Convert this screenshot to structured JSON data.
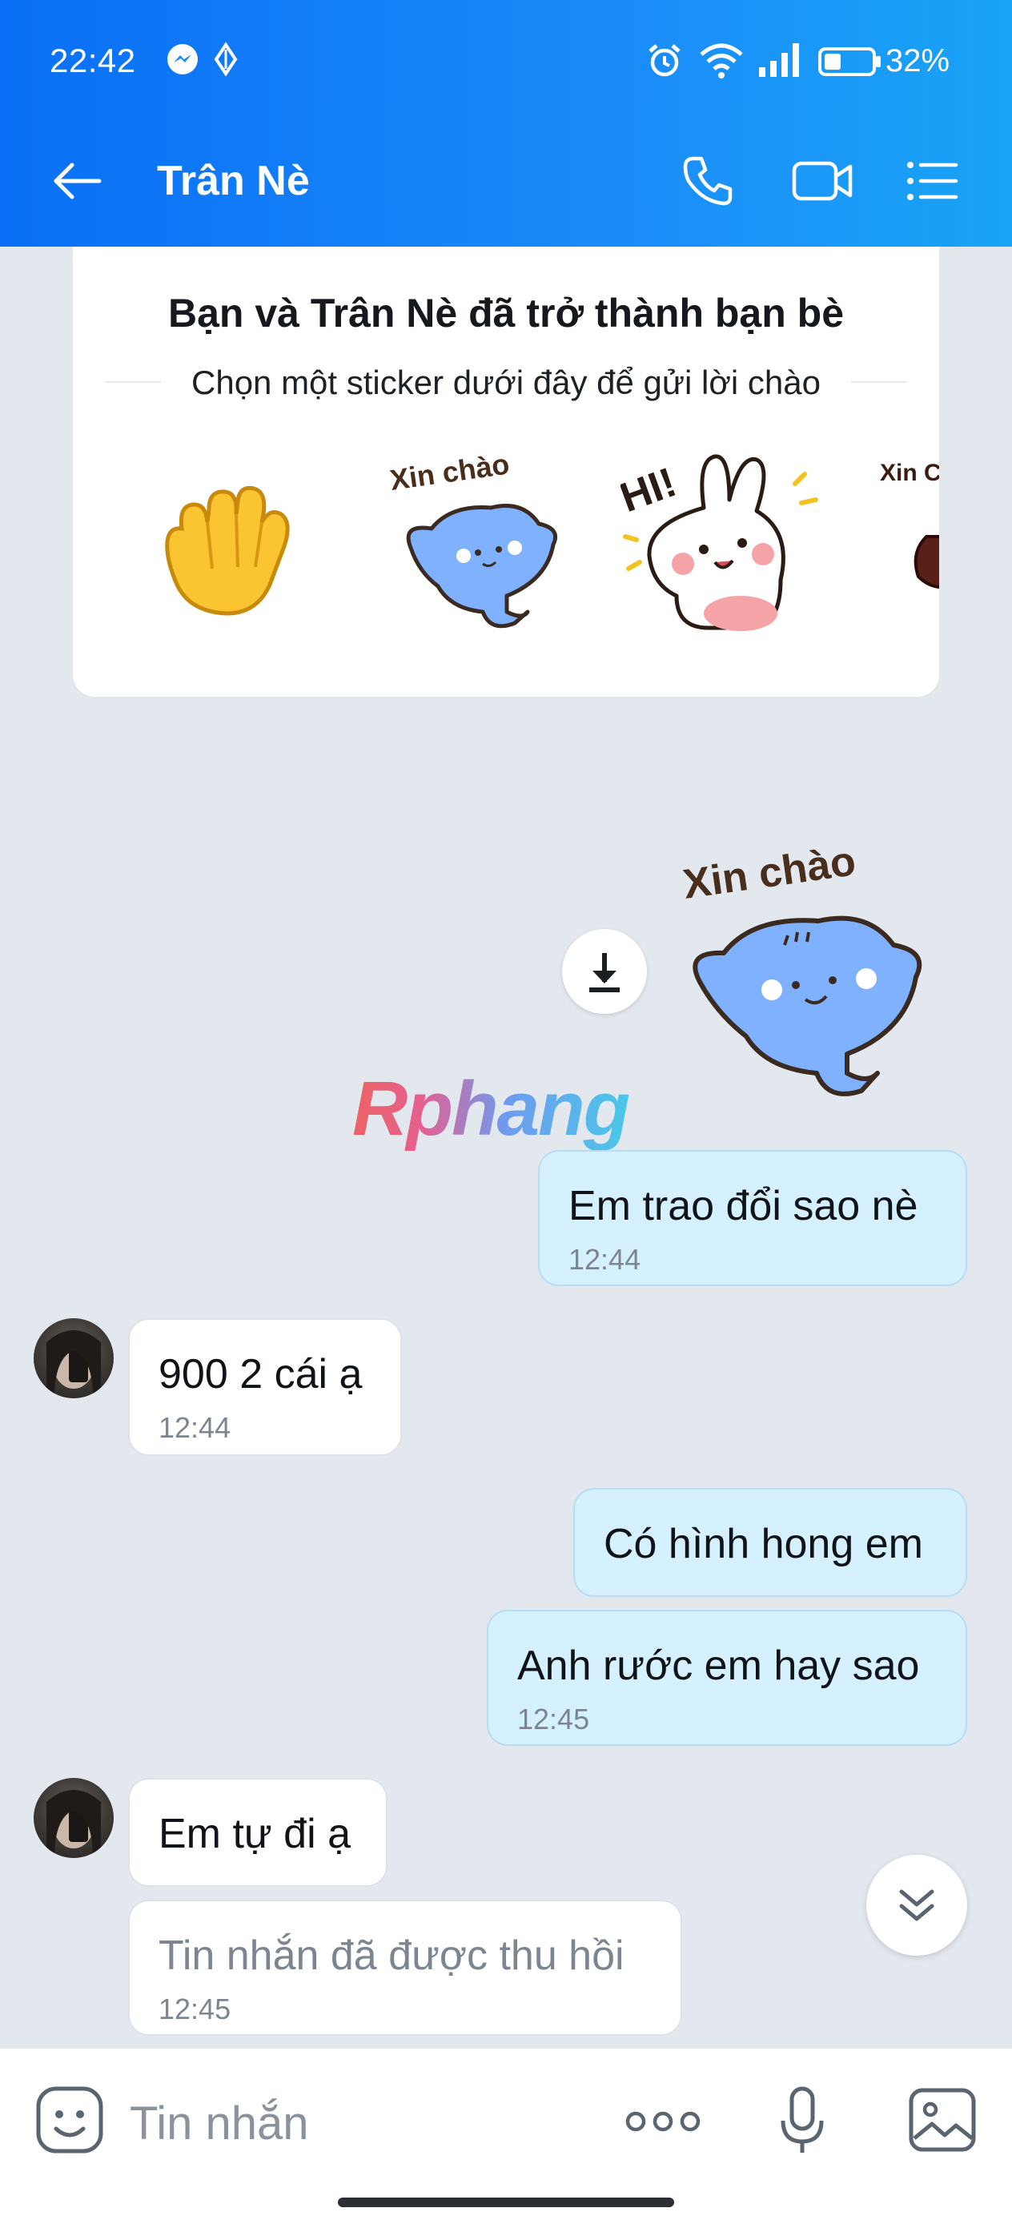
{
  "status_bar": {
    "time": "22:42",
    "battery": "32%",
    "icons": [
      "messenger-icon",
      "location-icon",
      "alarm-icon",
      "wifi-icon",
      "signal-icon",
      "battery-icon"
    ]
  },
  "app_bar": {
    "title": "Trân Nè",
    "back_icon": "arrow-left-icon",
    "actions": [
      "phone-icon",
      "video-call-icon",
      "menu-list-icon"
    ]
  },
  "friend_card": {
    "title": "Bạn và Trân Nè đã trở thành bạn bè",
    "subtitle": "Chọn một sticker dưới đây để gửi lời chào",
    "stickers": [
      {
        "name": "wave-hand-sticker"
      },
      {
        "name": "xin-chao-cat-sticker",
        "text": "Xin chào"
      },
      {
        "name": "hi-bunny-sticker",
        "text": "HI!"
      },
      {
        "name": "xin-chao-partial-sticker",
        "text": "Xin Chà"
      }
    ]
  },
  "watermark": "Rphang",
  "messages": [
    {
      "side": "out",
      "type": "sticker",
      "sticker_text": "Xin chào"
    },
    {
      "side": "out",
      "text": "Em trao đổi sao nè",
      "time": "12:44"
    },
    {
      "side": "in",
      "text": "900 2 cái ạ",
      "time": "12:44"
    },
    {
      "side": "out",
      "text": "Có hình hong em",
      "time": ""
    },
    {
      "side": "out",
      "text": "Anh rước em hay sao",
      "time": "12:45"
    },
    {
      "side": "in",
      "text": "Em tự đi ạ",
      "time": ""
    },
    {
      "side": "in",
      "text": "Tin nhắn đã được thu hồi",
      "time": "12:45",
      "recalled": true
    }
  ],
  "composer": {
    "placeholder": "Tin nhắn",
    "icons": [
      "sticker-emoji-icon",
      "more-icon",
      "microphone-icon",
      "image-icon"
    ]
  },
  "colors": {
    "header_start": "#0a6ff6",
    "header_end": "#19a4f6",
    "background": "#e3e8ef",
    "bubble_out": "#d5f1ff",
    "bubble_in": "#ffffff"
  }
}
